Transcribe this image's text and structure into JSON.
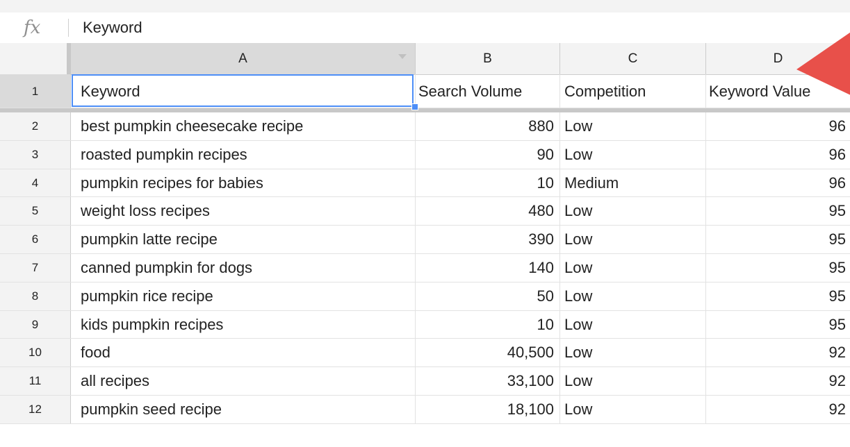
{
  "formula_bar": {
    "icon": "fx-icon",
    "value": "Keyword"
  },
  "columns": [
    {
      "id": "A",
      "label": "A"
    },
    {
      "id": "B",
      "label": "B"
    },
    {
      "id": "C",
      "label": "C"
    },
    {
      "id": "D",
      "label": "D"
    }
  ],
  "header_row": {
    "num": "1",
    "cells": [
      "Keyword",
      "Search Volume",
      "Competition",
      "Keyword Value"
    ]
  },
  "rows": [
    {
      "num": "2",
      "keyword": "best pumpkin cheesecake recipe",
      "volume": "880",
      "competition": "Low",
      "value": "96"
    },
    {
      "num": "3",
      "keyword": "roasted pumpkin recipes",
      "volume": "90",
      "competition": "Low",
      "value": "96"
    },
    {
      "num": "4",
      "keyword": "pumpkin recipes for babies",
      "volume": "10",
      "competition": "Medium",
      "value": "96"
    },
    {
      "num": "5",
      "keyword": "weight loss recipes",
      "volume": "480",
      "competition": "Low",
      "value": "95"
    },
    {
      "num": "6",
      "keyword": "pumpkin latte recipe",
      "volume": "390",
      "competition": "Low",
      "value": "95"
    },
    {
      "num": "7",
      "keyword": "canned pumpkin for dogs",
      "volume": "140",
      "competition": "Low",
      "value": "95"
    },
    {
      "num": "8",
      "keyword": "pumpkin rice recipe",
      "volume": "50",
      "competition": "Low",
      "value": "95"
    },
    {
      "num": "9",
      "keyword": "kids pumpkin recipes",
      "volume": "10",
      "competition": "Low",
      "value": "95"
    },
    {
      "num": "10",
      "keyword": "food",
      "volume": "40,500",
      "competition": "Low",
      "value": "92"
    },
    {
      "num": "11",
      "keyword": "all recipes",
      "volume": "33,100",
      "competition": "Low",
      "value": "92"
    },
    {
      "num": "12",
      "keyword": "pumpkin seed recipe",
      "volume": "18,100",
      "competition": "Low",
      "value": "92"
    }
  ],
  "colors": {
    "selection": "#4d8ef7",
    "arrow": "#e8504a"
  }
}
